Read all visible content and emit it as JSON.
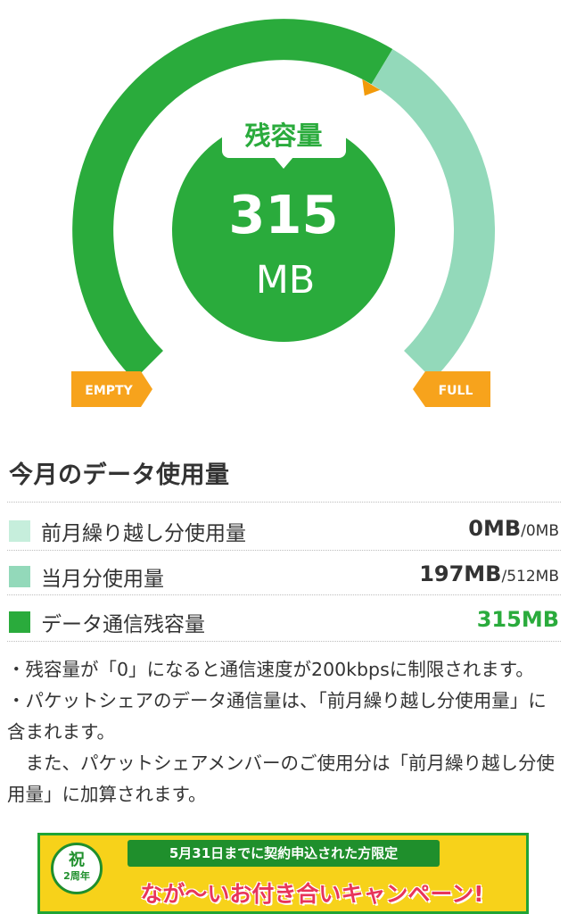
{
  "gauge": {
    "label": "残容量",
    "remaining_value": "315",
    "unit": "MB",
    "empty_label": "EMPTY",
    "full_label": "FULL",
    "used_fraction": 0.385,
    "colors": {
      "remaining": "#2aab3c",
      "used": "#93d9ba",
      "marker": "#f29a0a",
      "badge": "#f7a31c"
    }
  },
  "usage": {
    "title": "今月のデータ使用量",
    "rows": [
      {
        "label": "前月繰り越し分使用量",
        "value_bold": "0MB",
        "value_rest": "/0MB",
        "swatch": "#c6eedc",
        "value_color": "#333333"
      },
      {
        "label": "当月分使用量",
        "value_bold": "197MB",
        "value_rest": "/512MB",
        "swatch": "#93d9ba",
        "value_color": "#333333"
      },
      {
        "label": "データ通信残容量",
        "value_bold": "315MB",
        "value_rest": "",
        "swatch": "#2aab3c",
        "value_color": "#2aab3c"
      }
    ]
  },
  "notes": {
    "line1": "・残容量が「0」になると通信速度が200kbpsに制限されます。",
    "line2": "・パケットシェアのデータ通信量は、「前月繰り越し分使用量」に含まれます。",
    "line3": "　また、パケットシェアメンバーのご使用分は「前月繰り越し分使用量」に加算されます。"
  },
  "banner": {
    "seal_top": "祝",
    "seal_bottom": "2周年",
    "ribbon": "5月31日までに契約申込された方限定",
    "headline": "なが〜いお付き合いキャンペーン!"
  }
}
